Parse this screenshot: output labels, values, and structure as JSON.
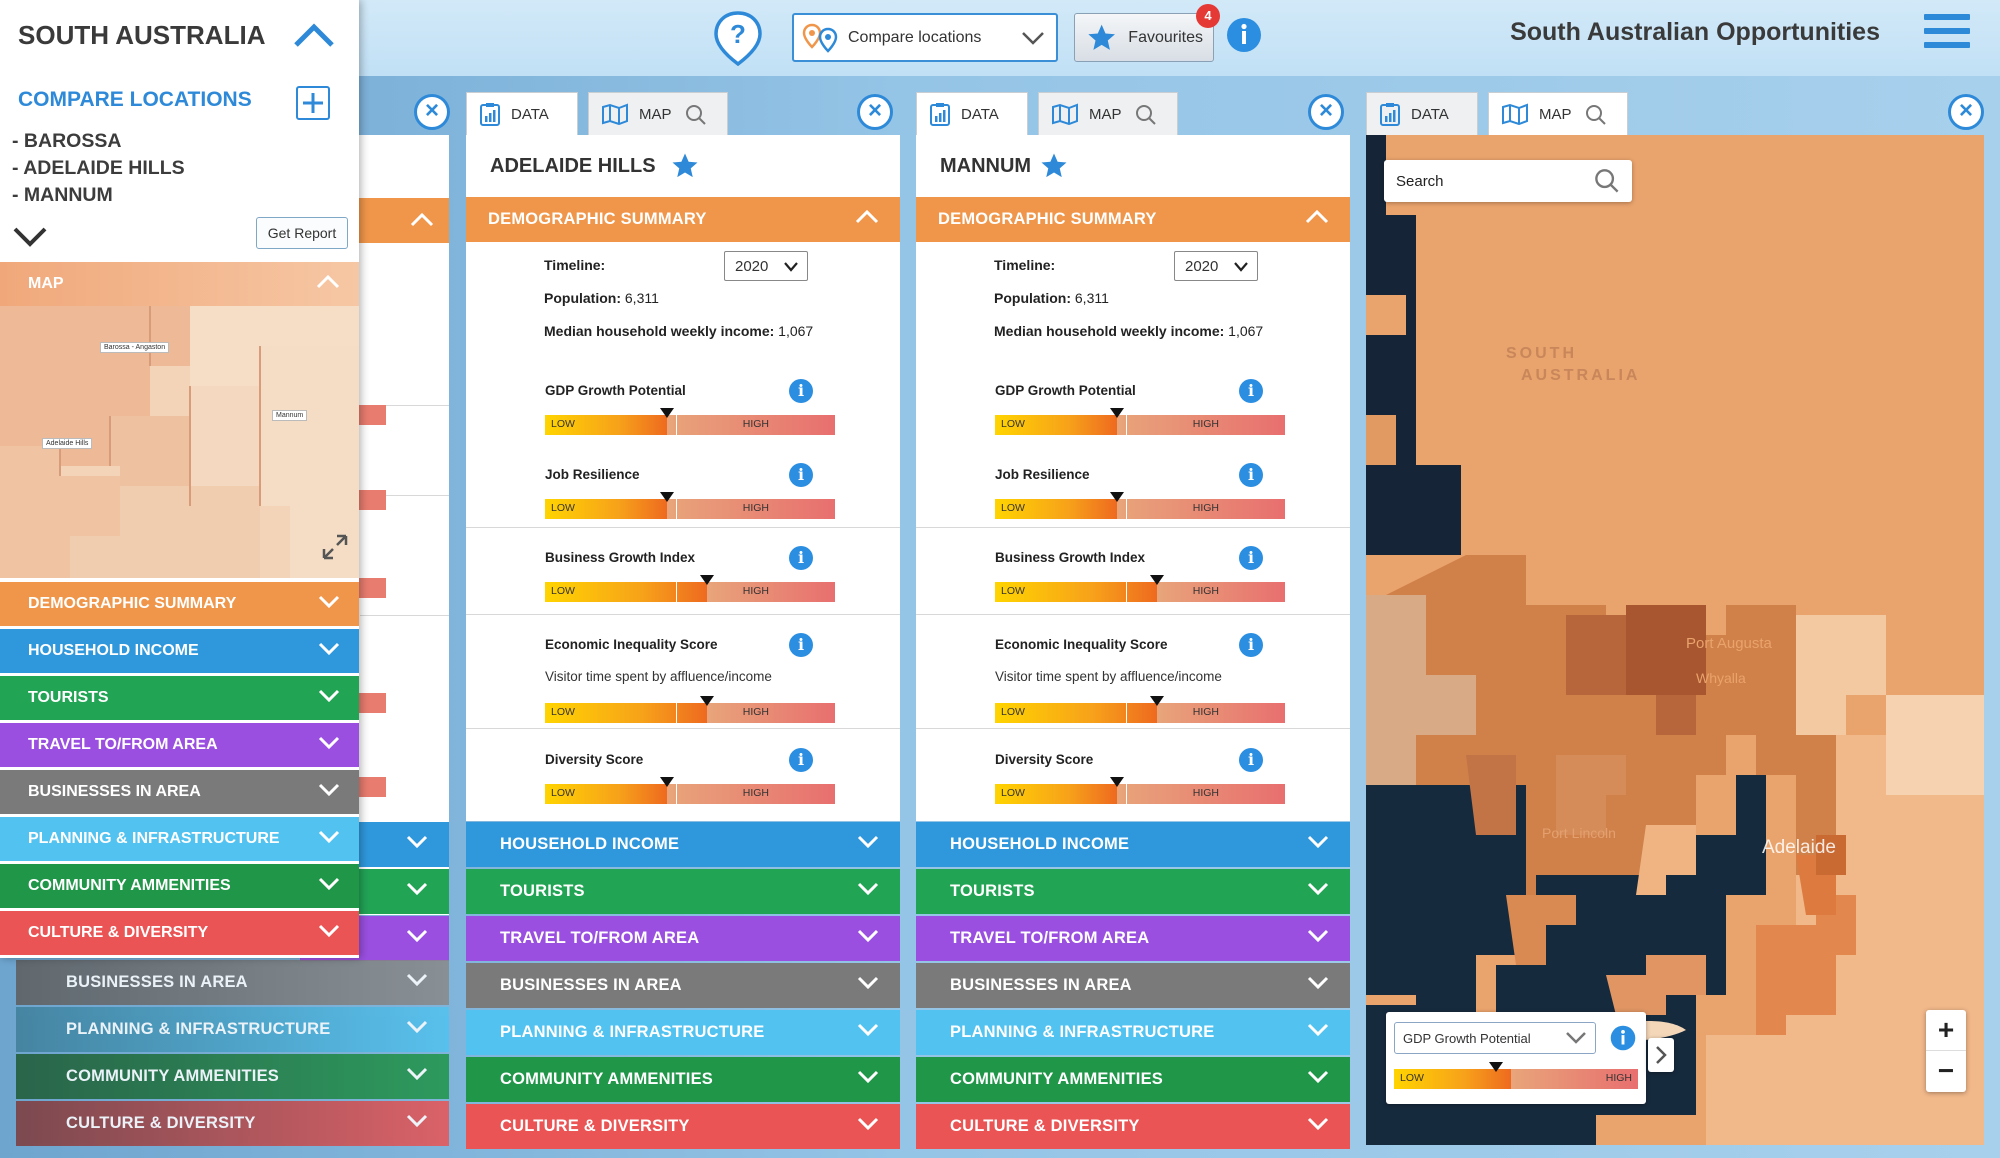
{
  "header": {
    "compare_select": "Compare locations",
    "favourites_label": "Favourites",
    "favourites_count": "4",
    "app_title": "South Australian Opportunities"
  },
  "sidebar": {
    "title": "SOUTH AUSTRALIA",
    "compare_title": "COMPARE LOCATIONS",
    "locations": [
      "- BAROSSA",
      "- ADELAIDE HILLS",
      "- MANNUM"
    ],
    "get_report": "Get Report",
    "map_label": "MAP",
    "map_places": [
      "Barossa - Angaston",
      "Mannum",
      "Adelaide Hills"
    ],
    "sections": [
      "DEMOGRAPHIC SUMMARY",
      "HOUSEHOLD INCOME",
      "TOURISTS",
      "TRAVEL TO/FROM AREA",
      "BUSINESSES IN AREA",
      "PLANNING & INFRASTRUCTURE",
      "COMMUNITY AMMENITIES",
      "CULTURE & DIVERSITY"
    ]
  },
  "tabs": {
    "data": "DATA",
    "map": "MAP"
  },
  "panels": [
    {
      "title": "ADELAIDE HILLS",
      "demo_label": "DEMOGRAPHIC SUMMARY",
      "timeline_label": "Timeline:",
      "year": "2020",
      "population_label": "Population:",
      "population": "6,311",
      "income_label": "Median household weekly income:",
      "income": "1,067",
      "metrics": [
        {
          "name": "GDP Growth Potential",
          "level": 0.42
        },
        {
          "name": "Job Resilience",
          "level": 0.42
        },
        {
          "name": "Business Growth Index",
          "level": 0.56
        },
        {
          "name": "Economic Inequality Score",
          "sub": "Visitor time spent by affluence/income",
          "level": 0.56
        },
        {
          "name": "Diversity Score",
          "level": 0.42
        }
      ],
      "low": "LOW",
      "high": "HIGH",
      "sections": [
        "HOUSEHOLD INCOME",
        "TOURISTS",
        "TRAVEL TO/FROM AREA",
        "BUSINESSES IN AREA",
        "PLANNING & INFRASTRUCTURE",
        "COMMUNITY AMMENITIES",
        "CULTURE & DIVERSITY"
      ]
    },
    {
      "title": "MANNUM",
      "demo_label": "DEMOGRAPHIC SUMMARY",
      "timeline_label": "Timeline:",
      "year": "2020",
      "population_label": "Population:",
      "population": "6,311",
      "income_label": "Median household weekly income:",
      "income": "1,067",
      "metrics": [
        {
          "name": "GDP Growth Potential",
          "level": 0.42
        },
        {
          "name": "Job Resilience",
          "level": 0.42
        },
        {
          "name": "Business Growth Index",
          "level": 0.56
        },
        {
          "name": "Economic Inequality Score",
          "sub": "Visitor time spent by affluence/income",
          "level": 0.56
        },
        {
          "name": "Diversity Score",
          "level": 0.42
        }
      ],
      "low": "LOW",
      "high": "HIGH",
      "sections": [
        "HOUSEHOLD INCOME",
        "TOURISTS",
        "TRAVEL TO/FROM AREA",
        "BUSINESSES IN AREA",
        "PLANNING & INFRASTRUCTURE",
        "COMMUNITY AMMENITIES",
        "CULTURE & DIVERSITY"
      ]
    }
  ],
  "back_panel_sections": [
    "BUSINESSES IN AREA",
    "PLANNING & INFRASTRUCTURE",
    "COMMUNITY AMMENITIES",
    "CULTURE & DIVERSITY"
  ],
  "map_panel": {
    "search_placeholder": "Search",
    "labels": [
      "SOUTH",
      "AUSTRALIA",
      "Port Augusta",
      "Whyalla",
      "Port Lincoln",
      "Adelaide"
    ],
    "legend_select": "GDP Growth Potential",
    "legend_low": "LOW",
    "legend_high": "HIGH",
    "zoom_in": "+",
    "zoom_out": "−"
  },
  "colors": {
    "accent": "#2e8ad8",
    "demographic": "#f0964a",
    "household": "#2f98dc",
    "tourists": "#22a455",
    "travel": "#9a4fe0",
    "business": "#7a7a7a",
    "planning": "#52c3f0",
    "community": "#1f9648",
    "culture": "#ea5454",
    "ocean": "#162a3e"
  }
}
